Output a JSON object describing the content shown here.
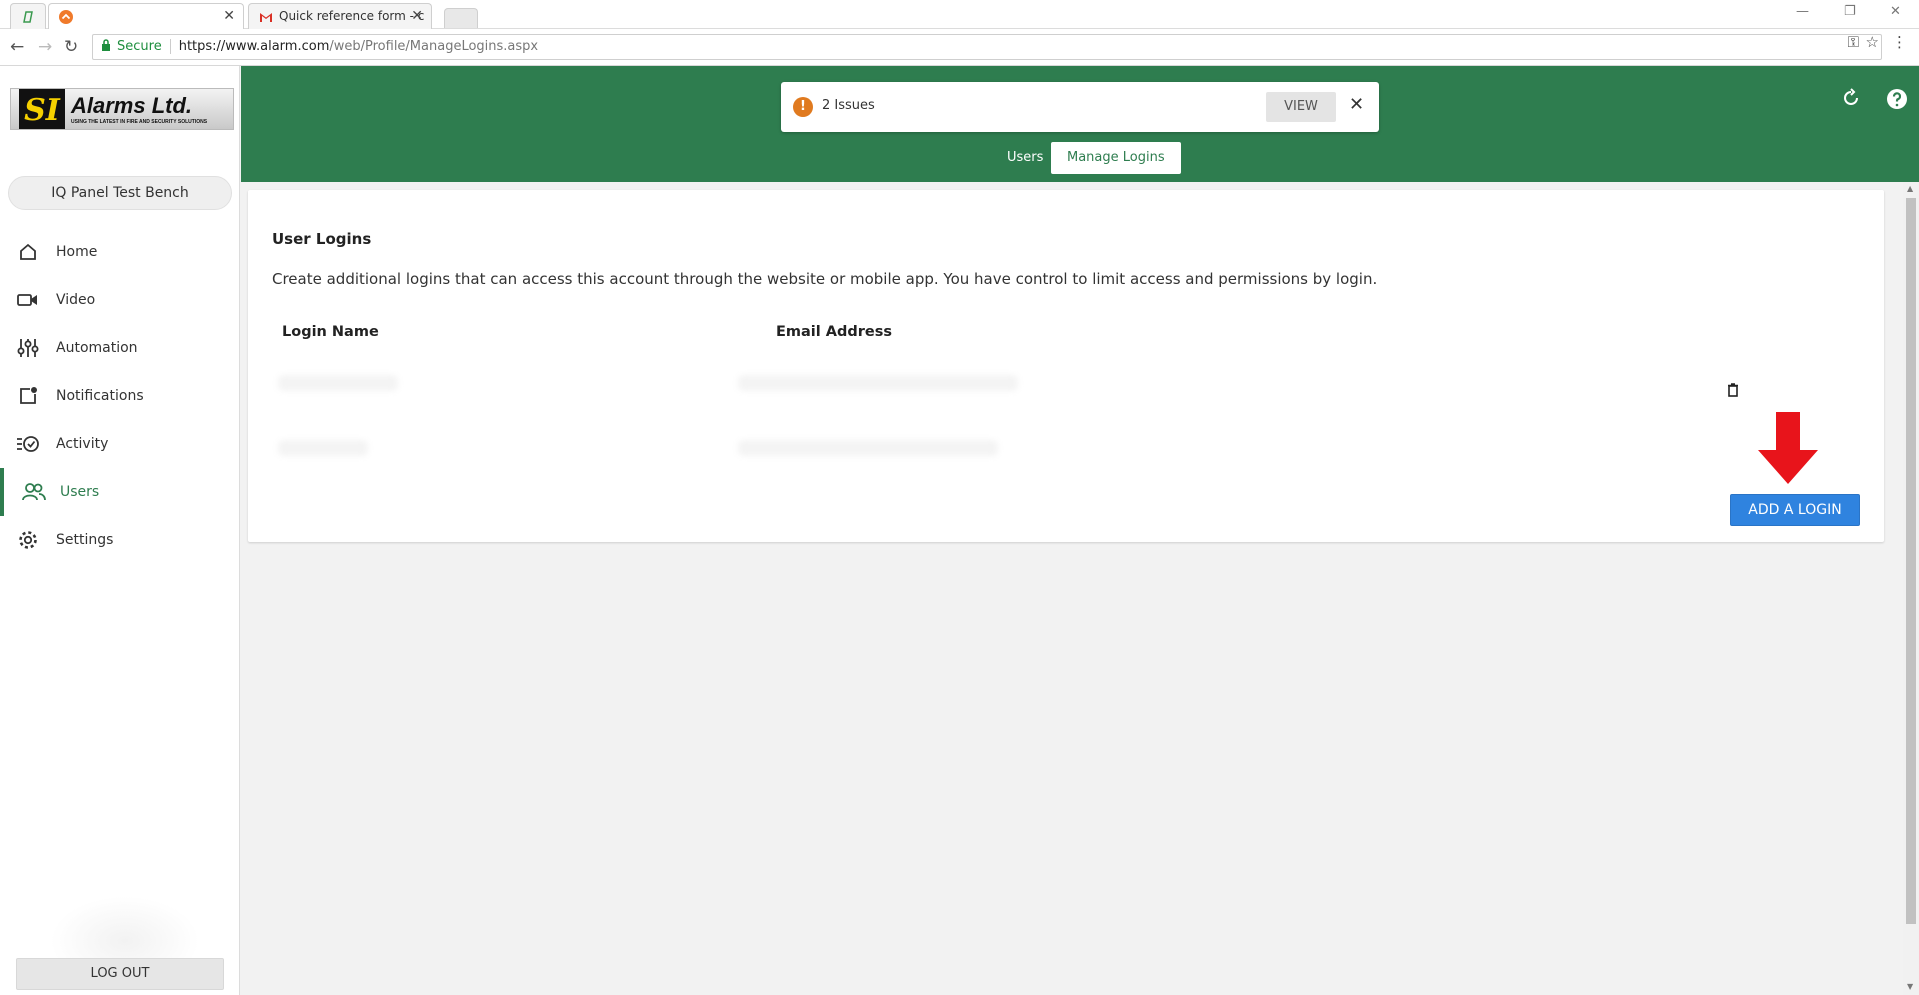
{
  "browser": {
    "tabs": [
      {
        "label": ""
      },
      {
        "label": ""
      },
      {
        "label": "Quick reference form - c"
      }
    ],
    "secure_label": "Secure",
    "url_host": "https://www.alarm.com",
    "url_path": "/web/Profile/ManageLogins.aspx"
  },
  "logo": {
    "mark": "SI",
    "name": "Alarms Ltd.",
    "tagline": "USING THE LATEST IN FIRE AND SECURITY SOLUTIONS"
  },
  "sidebar": {
    "account": "IQ Panel Test Bench",
    "items": [
      {
        "label": "Home",
        "icon": "home-icon"
      },
      {
        "label": "Video",
        "icon": "video-icon"
      },
      {
        "label": "Automation",
        "icon": "sliders-icon"
      },
      {
        "label": "Notifications",
        "icon": "notification-icon"
      },
      {
        "label": "Activity",
        "icon": "activity-icon"
      },
      {
        "label": "Users",
        "icon": "users-icon",
        "active": true
      },
      {
        "label": "Settings",
        "icon": "gear-icon"
      }
    ],
    "logout_label": "LOG OUT"
  },
  "header": {
    "alert_text": "2 Issues",
    "alert_icon": "!",
    "view_label": "VIEW",
    "tabs": [
      {
        "label": "Users"
      },
      {
        "label": "Manage Logins",
        "active": true
      }
    ]
  },
  "main": {
    "title": "User Logins",
    "description": "Create additional logins that can access this account through the website or mobile app. You have control to limit access and permissions by login.",
    "columns": [
      "Login Name",
      "Email Address"
    ],
    "add_button": "ADD A LOGIN"
  },
  "colors": {
    "brand_green": "#2e7d4f",
    "primary_blue": "#2f83df",
    "alert_orange": "#e07a1f",
    "annotation_red": "#e8141b"
  }
}
